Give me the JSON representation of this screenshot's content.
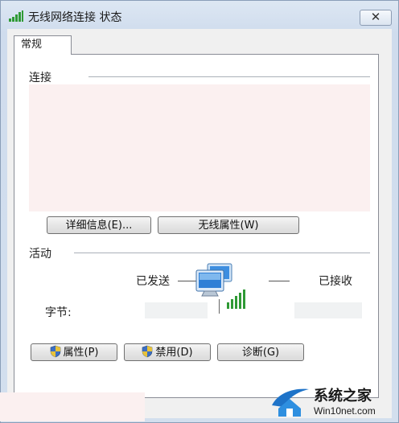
{
  "window": {
    "title": "无线网络连接 状态",
    "close_glyph": "✕"
  },
  "tabs": [
    {
      "label": "常规"
    }
  ],
  "connection": {
    "group_label": "连接"
  },
  "buttons": {
    "details": "详细信息(E)...",
    "wireless_props": "无线属性(W)",
    "properties": "属性(P)",
    "disable": "禁用(D)",
    "diagnose": "诊断(G)"
  },
  "activity": {
    "group_label": "活动",
    "sent_label": "已发送",
    "received_label": "已接收",
    "bytes_label": "字节:"
  },
  "icons": {
    "title": "signal-bars-icon",
    "network": "network-computers-icon",
    "shield": "uac-shield-icon"
  },
  "colors": {
    "accent_underline": "#c2182b",
    "signal_green": "#2f9a35"
  },
  "watermark": {
    "title": "系统之家",
    "url": "Win10net.com"
  }
}
